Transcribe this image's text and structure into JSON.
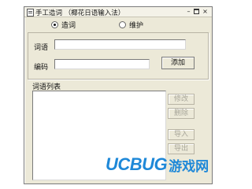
{
  "window": {
    "title": "手工造词 （椰花日语输入法）",
    "icon": "notepad-icon",
    "controls": {
      "minimize": "–",
      "close": "×"
    }
  },
  "mode": {
    "options": [
      "造词",
      "维护"
    ],
    "selected": "造词"
  },
  "form": {
    "word_label": "词语",
    "word_value": "",
    "code_label": "编码",
    "code_value": "",
    "add_button": "添加"
  },
  "list": {
    "label": "词语列表",
    "items": []
  },
  "actions": {
    "modify": "修改",
    "delete": "删除",
    "import": "导入",
    "export": "导出",
    "enabled": false
  },
  "watermark": {
    "latin": "UCBUG",
    "han": "游戏网"
  },
  "colors": {
    "dialog_bg": "#ece9d8",
    "watermark": "#1e88d8"
  }
}
